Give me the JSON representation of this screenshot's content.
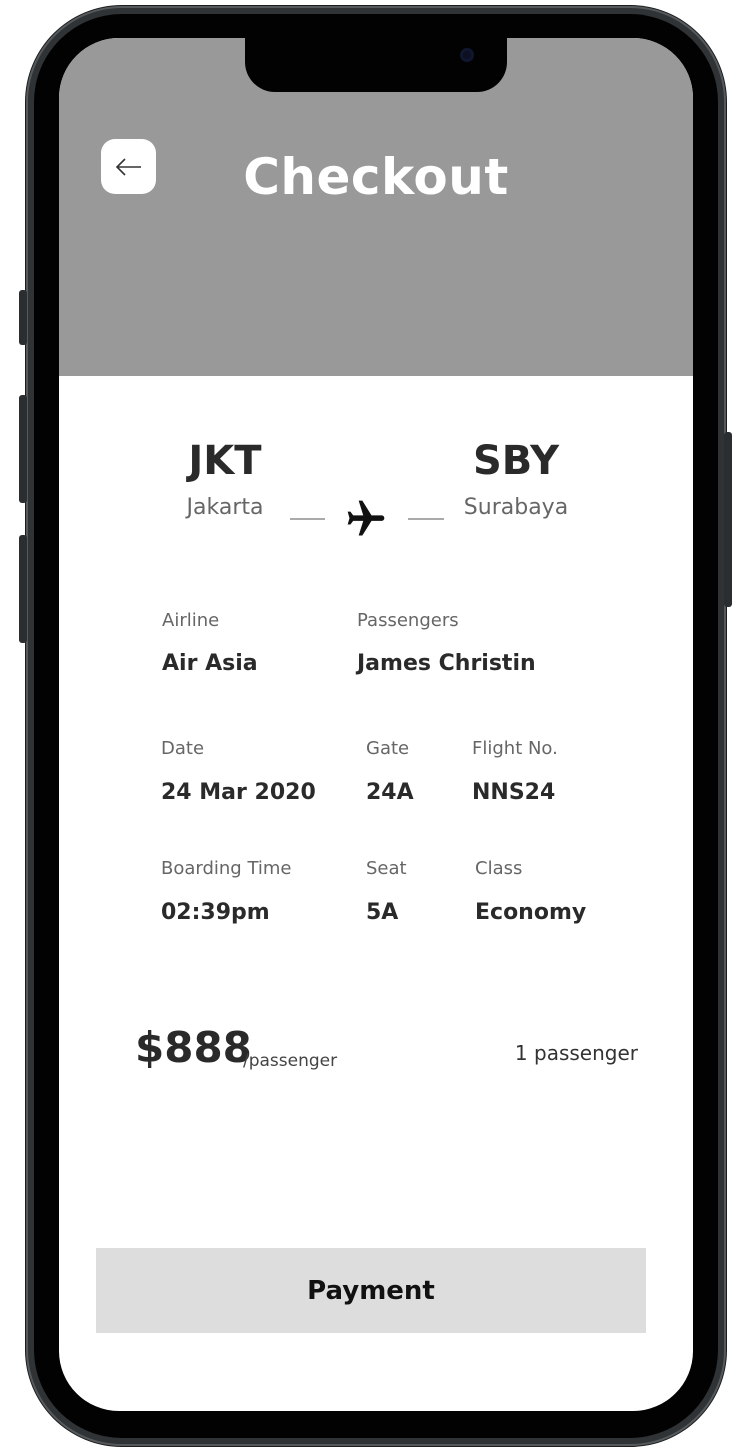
{
  "header": {
    "title": "Checkout",
    "back_icon": "arrow-left-icon"
  },
  "route": {
    "from": {
      "code": "JKT",
      "city": "Jakarta"
    },
    "to": {
      "code": "SBY",
      "city": "Surabaya"
    },
    "icon": "airplane-icon"
  },
  "details": {
    "airline": {
      "label": "Airline",
      "value": "Air Asia"
    },
    "passengers": {
      "label": "Passengers",
      "value": "James Christin"
    },
    "date": {
      "label": "Date",
      "value": "24 Mar 2020"
    },
    "gate": {
      "label": "Gate",
      "value": "24A"
    },
    "flight_no": {
      "label": "Flight No.",
      "value": "NNS24"
    },
    "boarding_time": {
      "label": "Boarding Time",
      "value": "02:39pm"
    },
    "seat": {
      "label": "Seat",
      "value": "5A"
    },
    "class": {
      "label": "Class",
      "value": "Economy"
    }
  },
  "pricing": {
    "price": "$888",
    "unit": "/passenger",
    "count": "1 passenger"
  },
  "actions": {
    "payment_label": "Payment"
  },
  "colors": {
    "header_bg": "#999999",
    "button_bg": "#dddddd",
    "text_dark": "#2a2a2a",
    "text_muted": "#666666"
  }
}
